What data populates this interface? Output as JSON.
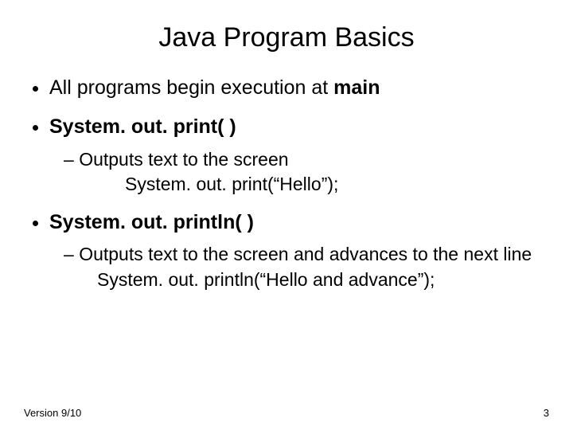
{
  "title": "Java Program Basics",
  "bullets": {
    "b1_pre": "All programs begin execution at ",
    "b1_bold": "main",
    "b2": "System. out. print( )",
    "b2_sub": "Outputs text to the screen",
    "b2_code": "System. out. print(“Hello”);",
    "b3": "System. out. println( )",
    "b3_sub": "Outputs text to the screen and advances to the next line",
    "b3_code": "System. out. println(“Hello and advance”);"
  },
  "footer": {
    "version": "Version 9/10",
    "page": "3"
  }
}
